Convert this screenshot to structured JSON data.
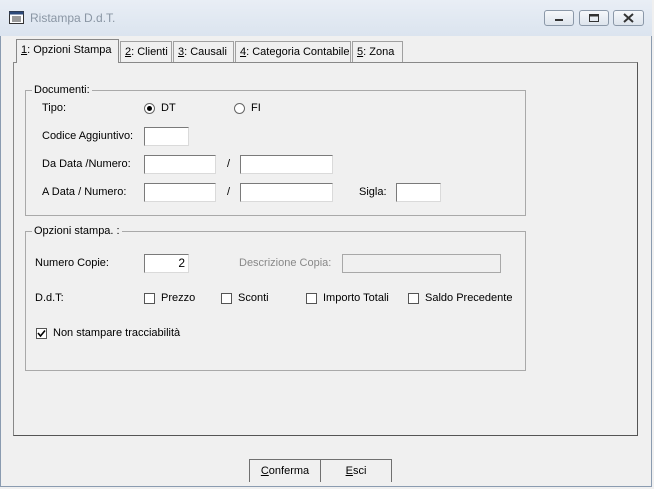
{
  "window": {
    "title": "Ristampa D.d.T."
  },
  "tabs": [
    {
      "key": "1",
      "label": ": Opzioni Stampa"
    },
    {
      "key": "2",
      "label": ": Clienti"
    },
    {
      "key": "3",
      "label": ": Causali"
    },
    {
      "key": "4",
      "label": ": Categoria Contabile"
    },
    {
      "key": "5",
      "label": ": Zona"
    }
  ],
  "documenti": {
    "legend": "Documenti:",
    "tipo_label": "Tipo:",
    "radio_dt": "DT",
    "radio_fi": "FI",
    "selected": "DT",
    "codice_label": "Codice Aggiuntivo:",
    "da_label": "Da Data /Numero:",
    "a_label": "A Data  / Numero:",
    "slash": "/",
    "sigla_label": "Sigla:"
  },
  "opzioni": {
    "legend": "Opzioni stampa. :",
    "copie_label": "Numero Copie:",
    "copie_value": "2",
    "descrizione_label": "Descrizione Copia:",
    "ddt_label": "D.d.T:",
    "chk_prezzo": "Prezzo",
    "chk_sconti": "Sconti",
    "chk_importo": "Importo Totali",
    "chk_saldo": "Saldo Precedente",
    "chk_tracciabilita": "Non stampare tracciabilità"
  },
  "buttons": {
    "conferma_first": "C",
    "conferma_rest": "onferma",
    "esci_first": "E",
    "esci_rest": "sci"
  }
}
